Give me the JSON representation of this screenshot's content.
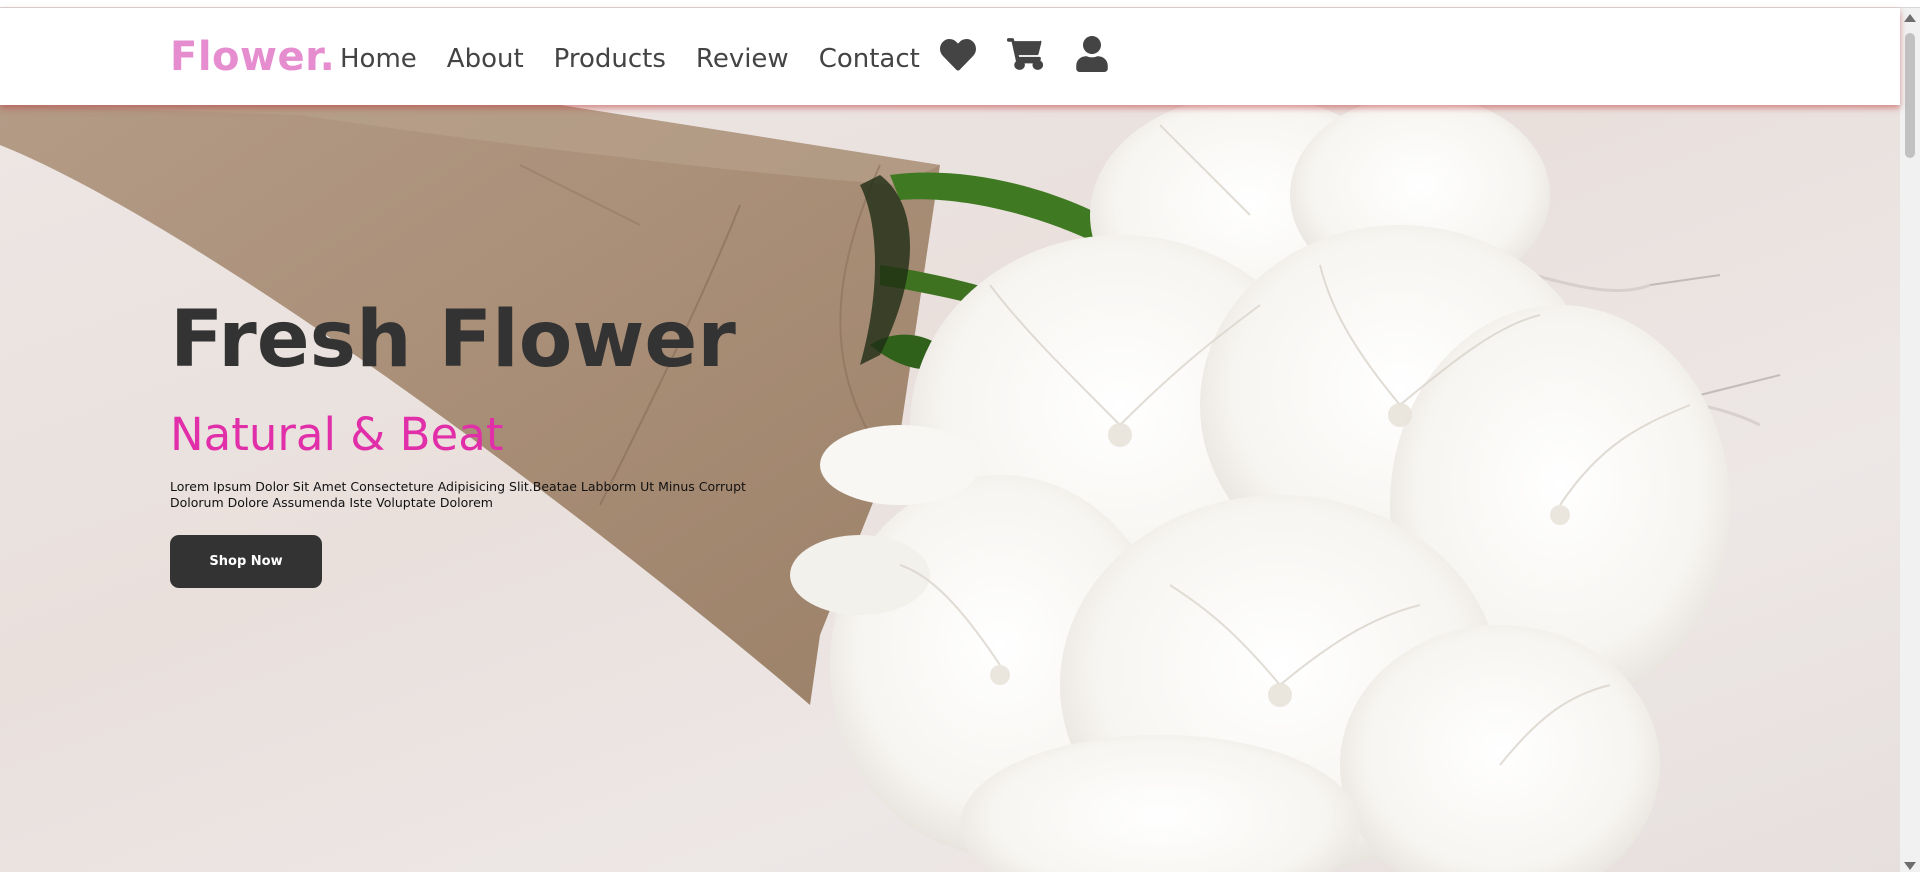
{
  "header": {
    "logo": "Flower.",
    "nav": [
      "Home",
      "About",
      "Products",
      "Review",
      "Contact"
    ],
    "icons": [
      "heart-icon",
      "cart-icon",
      "user-icon"
    ]
  },
  "hero": {
    "title": "Fresh Flower",
    "subtitle": "Natural & Beat",
    "description": "Lorem Ipsum Dolor Sit Amet Consecteture Adipisicing Slit.Beatae Labborm Ut Minus Corrupt Dolorum Dolore Assumenda Iste Voluptate Dolorem",
    "button": "Shop Now"
  },
  "colors": {
    "logo": "#e58dcf",
    "subtitle": "#e12fa9",
    "dark": "#333333"
  }
}
